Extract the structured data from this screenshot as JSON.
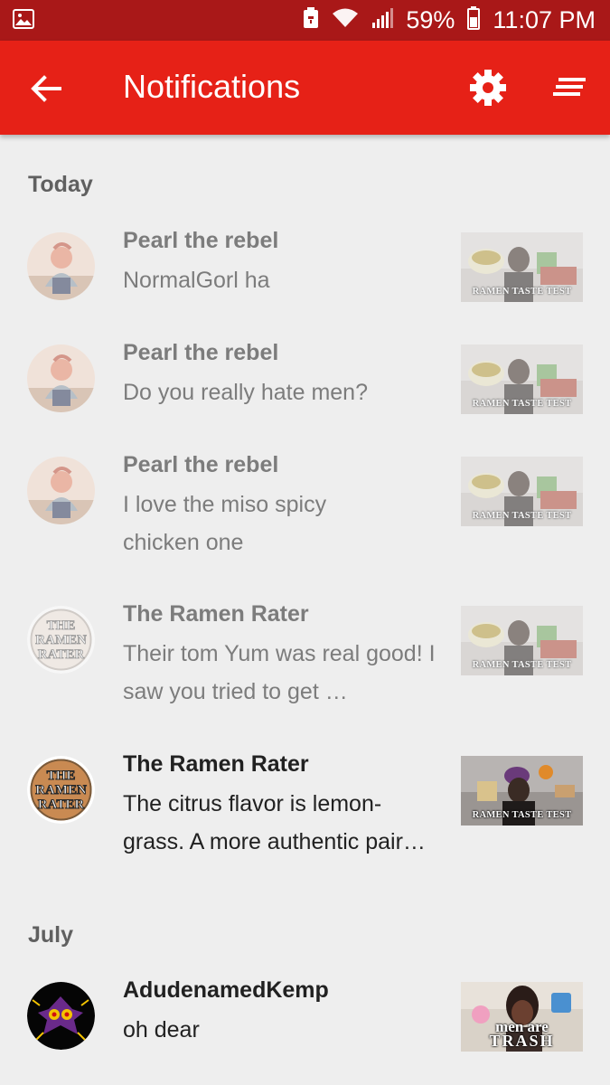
{
  "status_bar": {
    "battery_percent": "59%",
    "time": "11:07 PM"
  },
  "app_bar": {
    "title": "Notifications",
    "back_icon": "arrow-back-icon",
    "settings_icon": "gear-icon",
    "filter_icon": "filter-sort-icon"
  },
  "colors": {
    "status_bar": "#a91818",
    "app_bar": "#e62117",
    "background": "#eeeeee"
  },
  "sections": [
    {
      "header": "Today",
      "items": [
        {
          "author": "Pearl the rebel",
          "message": "NormalGorl ha",
          "thumb_caption": "RAMEN TASTE TEST",
          "read": true
        },
        {
          "author": "Pearl the rebel",
          "message": "Do you really hate men?",
          "thumb_caption": "RAMEN TASTE TEST",
          "read": true
        },
        {
          "author": "Pearl the rebel",
          "message": "I love the miso spicy chicken one",
          "thumb_caption": "RAMEN TASTE TEST",
          "read": true
        },
        {
          "author": "The Ramen Rater",
          "message": "Their tom Yum was real good! I saw you tried to get …",
          "thumb_caption": "RAMEN TASTE TEST",
          "read": true
        },
        {
          "author": "The Ramen Rater",
          "message": "The citrus flavor is lemon-grass. A more authentic pair…",
          "thumb_caption": "RAMEN TASTE TEST",
          "read": false
        }
      ]
    },
    {
      "header": "July",
      "items": [
        {
          "author": "AdudenamedKemp",
          "message": "oh dear",
          "thumb_caption_top": "men are",
          "thumb_caption_bottom": "TRASH",
          "read": false
        }
      ]
    }
  ],
  "avatar_labels": {
    "ramen_rater_line1": "THE",
    "ramen_rater_line2": "RAMEN",
    "ramen_rater_line3": "RATER"
  }
}
